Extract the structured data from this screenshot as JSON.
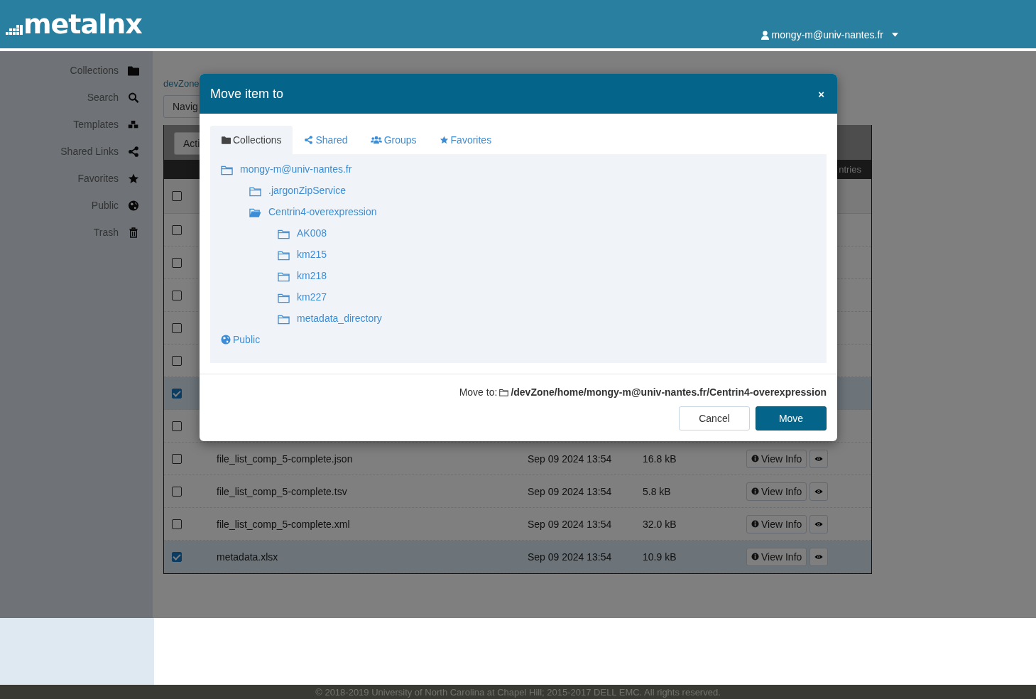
{
  "header": {
    "logo": "metalnx",
    "user": "mongy-m@univ-nantes.fr"
  },
  "sidebar": {
    "items": [
      {
        "label": "Collections"
      },
      {
        "label": "Search"
      },
      {
        "label": "Templates"
      },
      {
        "label": "Shared Links"
      },
      {
        "label": "Favorites"
      },
      {
        "label": "Public"
      },
      {
        "label": "Trash"
      }
    ]
  },
  "content": {
    "breadcrumb": "devZone",
    "navigate_button": "Navig",
    "actions_button": "Acti",
    "entries_text": "ntries",
    "table": {
      "header_checked": false,
      "rows": [
        {
          "selected": false
        },
        {
          "selected": false
        },
        {
          "selected": false
        },
        {
          "selected": false
        },
        {
          "selected": false
        },
        {
          "selected": true
        },
        {
          "selected": false
        },
        {
          "selected": false,
          "name": "file_list_comp_5-complete.json",
          "modified": "Sep 09 2024 13:54",
          "size": "16.8 kB",
          "info_button": "View Info"
        },
        {
          "selected": false,
          "name": "file_list_comp_5-complete.tsv",
          "modified": "Sep 09 2024 13:54",
          "size": "5.8 kB",
          "info_button": "View Info"
        },
        {
          "selected": false,
          "name": "file_list_comp_5-complete.xml",
          "modified": "Sep 09 2024 13:54",
          "size": "32.0 kB",
          "info_button": "View Info"
        },
        {
          "selected": true,
          "name": "metadata.xlsx",
          "modified": "Sep 09 2024 13:54",
          "size": "10.9 kB",
          "info_button": "View Info"
        }
      ]
    }
  },
  "modal": {
    "title": "Move item to",
    "close": "×",
    "tabs": [
      {
        "label": "Collections",
        "selected": true
      },
      {
        "label": "Shared",
        "selected": false
      },
      {
        "label": "Groups",
        "selected": false
      },
      {
        "label": "Favorites",
        "selected": false
      }
    ],
    "tree": [
      {
        "label": "mongy-m@univ-nantes.fr",
        "kind": "folder",
        "selected": false,
        "children": [
          {
            "label": ".jargonZipService",
            "kind": "folder",
            "selected": false
          },
          {
            "label": "Centrin4-overexpression",
            "kind": "folder",
            "selected": true,
            "children": [
              {
                "label": "AK008",
                "kind": "folder",
                "selected": false
              },
              {
                "label": "km215",
                "kind": "folder",
                "selected": false
              },
              {
                "label": "km218",
                "kind": "folder",
                "selected": false
              },
              {
                "label": "km227",
                "kind": "folder",
                "selected": false
              },
              {
                "label": "metadata_directory",
                "kind": "folder",
                "selected": false
              }
            ]
          }
        ]
      },
      {
        "label": "Public",
        "kind": "globe",
        "selected": false
      }
    ],
    "move_to_label": "Move to:",
    "move_to_path": "/devZone/home/mongy-m@univ-nantes.fr/Centrin4-overexpression",
    "buttons": [
      {
        "label": "Cancel",
        "kind": "default"
      },
      {
        "label": "Move",
        "kind": "primary"
      }
    ]
  },
  "footer": "© 2018-2019 University of North Carolina at Chapel Hill; 2015-2017 DELL EMC. All rights reserved."
}
